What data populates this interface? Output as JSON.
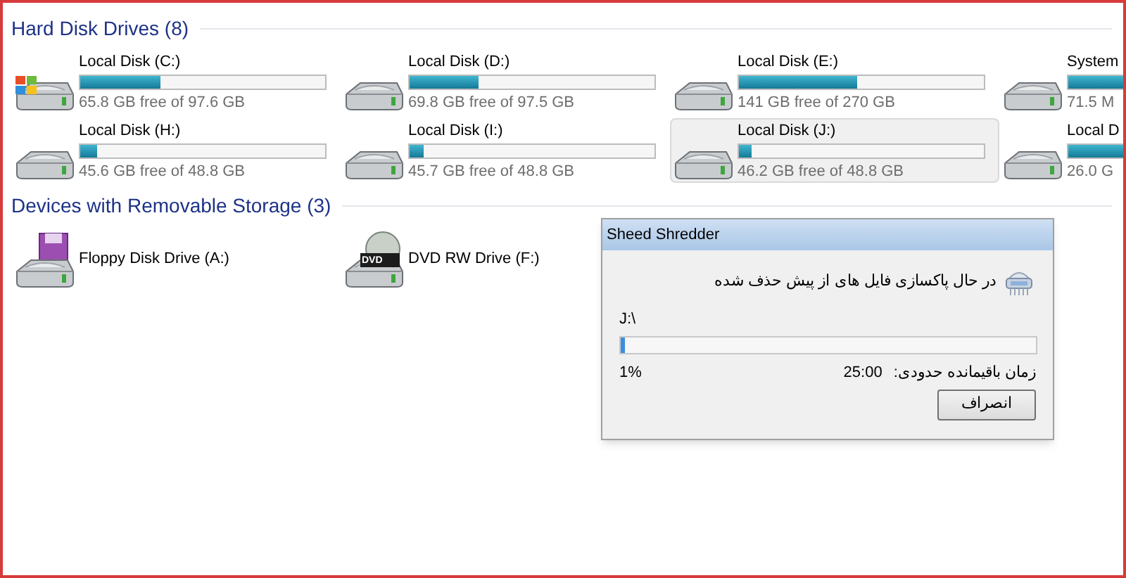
{
  "sections": [
    {
      "title": "Hard Disk Drives (8)",
      "kind": "bars",
      "items": [
        {
          "name": "Local Disk (C:)",
          "info": "65.8 GB free of 97.6 GB",
          "level": 0.33,
          "selected": false,
          "kind": "system"
        },
        {
          "name": "Local Disk (D:)",
          "info": "69.8 GB free of 97.5 GB",
          "level": 0.28,
          "selected": false,
          "kind": "disk"
        },
        {
          "name": "Local Disk (E:)",
          "info": "141 GB free of 270 GB",
          "level": 0.48,
          "selected": false,
          "kind": "disk"
        },
        {
          "name": "System",
          "info": "71.5 M",
          "level": 0.5,
          "selected": false,
          "kind": "disk"
        },
        {
          "name": "Local Disk (H:)",
          "info": "45.6 GB free of 48.8 GB",
          "level": 0.07,
          "selected": false,
          "kind": "disk"
        },
        {
          "name": "Local Disk (I:)",
          "info": "45.7 GB free of 48.8 GB",
          "level": 0.06,
          "selected": false,
          "kind": "disk"
        },
        {
          "name": "Local Disk (J:)",
          "info": "46.2 GB free of 48.8 GB",
          "level": 0.05,
          "selected": true,
          "kind": "disk"
        },
        {
          "name": "Local D",
          "info": "26.0 G",
          "level": 0.5,
          "selected": false,
          "kind": "disk"
        }
      ]
    },
    {
      "title": "Devices with Removable Storage (3)",
      "kind": "plain",
      "items": [
        {
          "name": "Floppy Disk Drive (A:)",
          "selected": false,
          "kind": "floppy"
        },
        {
          "name": "DVD RW Drive (F:)",
          "selected": false,
          "kind": "dvd",
          "badge": "DVD"
        }
      ]
    }
  ],
  "dialog": {
    "title": "Sheed Shredder",
    "message": "در حال پاکسازی فایل های از پیش حذف شده",
    "path": "J:\\",
    "level": 0.01,
    "percent": "1%",
    "time_label": "زمان باقیمانده حدودی:",
    "time": "25:00",
    "cancel": "انصراف"
  }
}
